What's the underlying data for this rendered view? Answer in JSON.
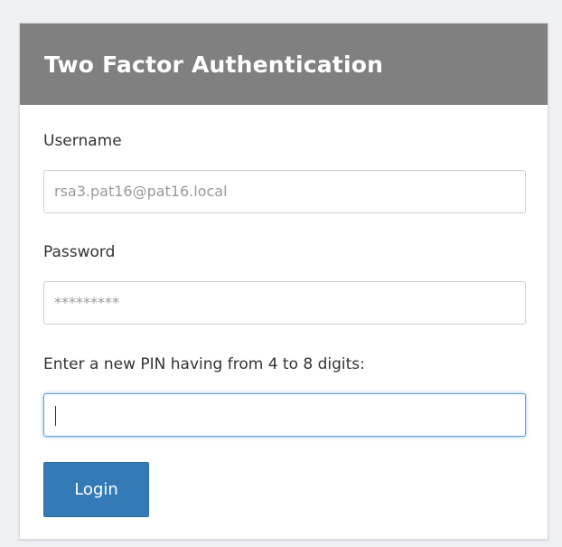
{
  "header": {
    "title": "Two Factor Authentication"
  },
  "form": {
    "username_label": "Username",
    "username_value": "rsa3.pat16@pat16.local",
    "password_label": "Password",
    "password_value": "*********",
    "pin_label": "Enter a new PIN having from 4 to 8 digits:",
    "pin_value": "",
    "login_label": "Login"
  },
  "colors": {
    "header_bg": "#808080",
    "button_bg": "#337ab7",
    "focus_border": "#5b9dd9"
  }
}
